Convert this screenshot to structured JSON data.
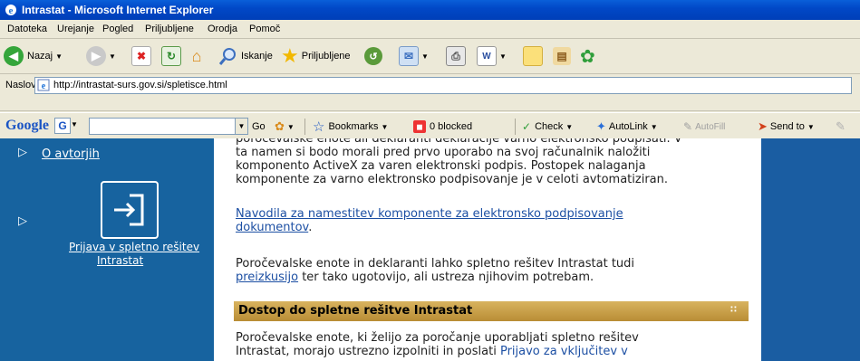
{
  "window": {
    "title": "Intrastat - Microsoft Internet Explorer"
  },
  "menu": [
    "Datoteka",
    "Urejanje",
    "Pogled",
    "Priljubljene",
    "Orodja",
    "Pomoč"
  ],
  "toolbar": {
    "back_label": "Nazaj",
    "search_label": "Iskanje",
    "favorites_label": "Priljubljene"
  },
  "address": {
    "label": "Naslov",
    "url": "http://intrastat-surs.gov.si/spletisce.html"
  },
  "google_toolbar": {
    "logo": "Google",
    "go_label": "Go",
    "bookmarks_label": "Bookmarks",
    "blocked_label": "0 blocked",
    "check_label": "Check",
    "autolink_label": "AutoLink",
    "autofill_label": "AutoFill",
    "sendto_label": "Send to"
  },
  "sidebar": {
    "about_label": "O avtorjih",
    "login_line1": "Prijava v spletno rešitev",
    "login_line2": "Intrastat"
  },
  "content": {
    "para1_line0": "poročevalske enote ali deklaranti deklaracije varno elektronsko podpisati. V",
    "para1_line1": "ta namen si bodo morali pred prvo uporabo na svoj računalnik naložiti",
    "para1_line2": "komponento ActiveX za varen elektronski podpis. Postopek nalaganja",
    "para1_line3": "komponente za varno elektronsko podpisovanje je v celoti avtomatiziran.",
    "link1_line1": "Navodila za namestitev komponente za elektronsko podpisovanje",
    "link1_line2": "dokumentov",
    "link1_after": ".",
    "para2_line1": "Poročevalske enote in deklaranti lahko spletno rešitev Intrastat tudi",
    "para2_link": "preizkusijo",
    "para2_after": " ter tako ugotovijo, ali ustreza njihovim potrebam.",
    "section_title": "Dostop do spletne rešitve Intrastat",
    "para3_line1": "Poročevalske enote, ki želijo za poročanje uporabljati spletno rešitev",
    "para3_line2_pre": "Intrastat, morajo ustrezno izpolniti in poslati ",
    "para3_line2_link": "Prijavo za vključitev v"
  }
}
